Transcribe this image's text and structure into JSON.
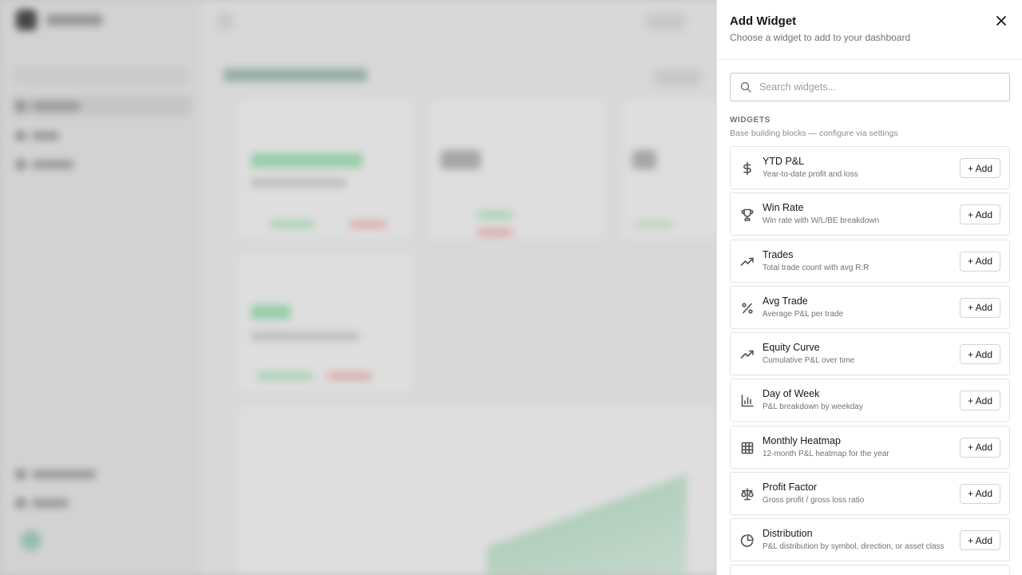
{
  "drawer": {
    "title": "Add Widget",
    "subtitle": "Choose a widget to add to your dashboard",
    "search_placeholder": "Search widgets...",
    "section_title": "WIDGETS",
    "section_subtitle": "Base building blocks — configure via settings",
    "add_label": "+ Add",
    "widgets": [
      {
        "name": "YTD P&L",
        "description": "Year-to-date profit and loss",
        "icon": "dollar-icon"
      },
      {
        "name": "Win Rate",
        "description": "Win rate with W/L/BE breakdown",
        "icon": "trophy-icon"
      },
      {
        "name": "Trades",
        "description": "Total trade count with avg R:R",
        "icon": "trending-up-icon"
      },
      {
        "name": "Avg Trade",
        "description": "Average P&L per trade",
        "icon": "percent-icon"
      },
      {
        "name": "Equity Curve",
        "description": "Cumulative P&L over time",
        "icon": "trending-up-icon"
      },
      {
        "name": "Day of Week",
        "description": "P&L breakdown by weekday",
        "icon": "bar-chart-icon"
      },
      {
        "name": "Monthly Heatmap",
        "description": "12-month P&L heatmap for the year",
        "icon": "grid-icon"
      },
      {
        "name": "Profit Factor",
        "description": "Gross profit / gross loss ratio",
        "icon": "scale-icon"
      },
      {
        "name": "Distribution",
        "description": "P&L distribution by symbol, direction, or asset class",
        "icon": "pie-chart-icon"
      }
    ]
  },
  "colors": {
    "accent_green": "#22c55e",
    "accent_red": "#ef4444",
    "border": "#e4e4e7"
  }
}
